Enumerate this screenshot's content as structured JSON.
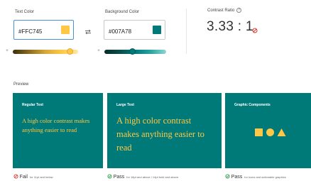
{
  "text_color": {
    "label": "Text Color",
    "hex": "#FFC745",
    "swatch": "#FFC745"
  },
  "swap_icon": "swap-arrows-icon",
  "background_color": {
    "label": "Background Color",
    "hex": "#007A78",
    "swatch": "#007A78"
  },
  "contrast": {
    "label": "Contrast Ratio",
    "value": "3.33 : 1",
    "status": "fail"
  },
  "sliders": {
    "text_lightness": 0.88,
    "background_lightness": 0.45
  },
  "preview": {
    "label": "Preview",
    "cards": {
      "regular": {
        "title": "Regular Text",
        "sample": "A high color contrast makes anything easier to read"
      },
      "large": {
        "title": "Large Text",
        "sample": "A high color contrast makes anything easier to read"
      },
      "graphic": {
        "title": "Graphic Components"
      }
    },
    "results": {
      "regular": {
        "word": "Fail",
        "note": "for 11pt and below"
      },
      "large": {
        "word": "Pass",
        "note": "for 18pt and above / 14pt bold and above"
      },
      "graphic": {
        "word": "Pass",
        "note": "for icons and actionable graphics"
      }
    }
  },
  "colors": {
    "accent_blue": "#4a90d9",
    "fail_red": "#d9342b",
    "pass_green": "#2e9e44",
    "teal": "#007A78",
    "yellow": "#FFC745"
  }
}
